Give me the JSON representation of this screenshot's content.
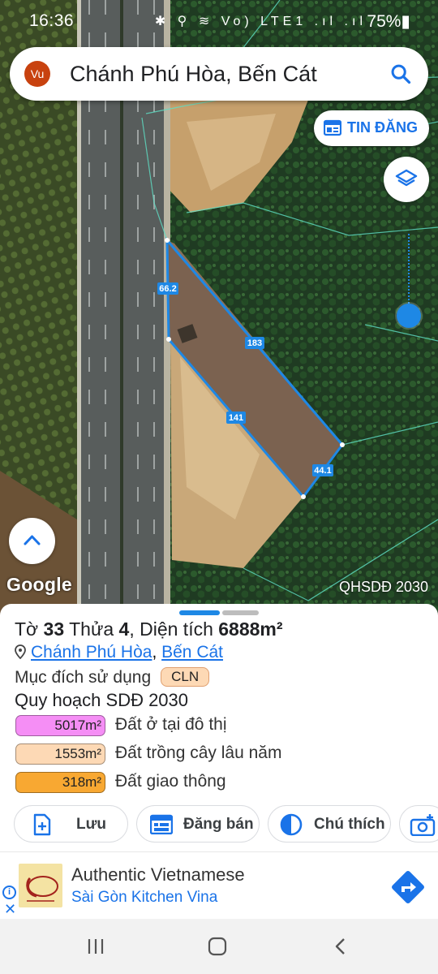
{
  "status_bar": {
    "time": "16:36",
    "icons": "✱ ⚲ ≋ Vo) LTE1 .ıl .ıl",
    "battery": "75%▮"
  },
  "search": {
    "avatar_text": "Vu",
    "query": "Chánh Phú Hòa, Bến Cát"
  },
  "map": {
    "tin_dang_label": "TIN ĐĂNG",
    "google_logo": "Google",
    "overlay_label": "QHSDĐ 2030",
    "parcel_edges": [
      "66.2",
      "183",
      "141",
      "44.1"
    ]
  },
  "sheet": {
    "title_to_label": "Tờ",
    "title_to_value": "33",
    "title_thua_label": "Thửa",
    "title_thua_value": "4",
    "title_area_label": ", Diện tích",
    "title_area_value": "6888m²",
    "ward": "Chánh Phú Hòa",
    "district": "Bến Cát",
    "purpose_label": "Mục đích sử dụng",
    "purpose_code": "CLN",
    "plan_title": "Quy hoạch SDĐ 2030",
    "zones": [
      {
        "area": "5017m²",
        "label": "Đất ở tại đô thị",
        "color": "#f58ef5"
      },
      {
        "area": "1553m²",
        "label": "Đất trồng cây lâu năm",
        "color": "#fdd9b5"
      },
      {
        "area": "318m²",
        "label": "Đất giao thông",
        "color": "#f8a832"
      }
    ],
    "actions": {
      "save": "Lưu",
      "sell": "Đăng bán",
      "legend": "Chú thích"
    }
  },
  "ad": {
    "title": "Authentic Vietnamese",
    "subtitle": "Sài Gòn Kitchen Vina"
  },
  "colors": {
    "accent": "#1a73e8",
    "parcel_outline": "#1e88e5"
  }
}
